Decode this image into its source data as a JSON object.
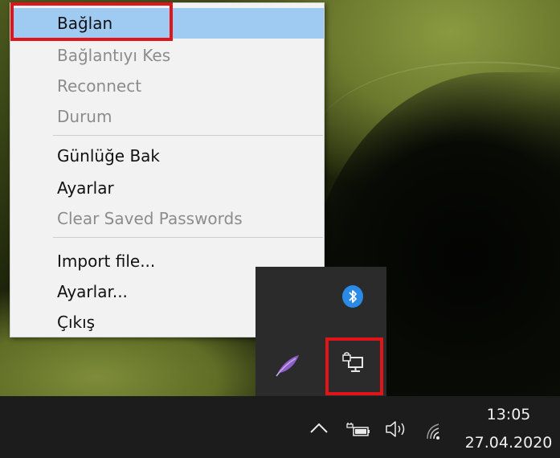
{
  "context_menu": {
    "items": [
      {
        "label": "Bağlan",
        "state": "highlighted"
      },
      {
        "label": "Bağlantıyı Kes",
        "state": "disabled"
      },
      {
        "label": "Reconnect",
        "state": "disabled"
      },
      {
        "label": "Durum",
        "state": "disabled"
      },
      {
        "label": "Günlüğe Bak",
        "state": "enabled"
      },
      {
        "label": "Ayarlar",
        "state": "enabled"
      },
      {
        "label": "Clear Saved Passwords",
        "state": "disabled"
      },
      {
        "label": "Import file...",
        "state": "enabled"
      },
      {
        "label": "Ayarlar...",
        "state": "enabled"
      },
      {
        "label": "Çıkış",
        "state": "enabled"
      }
    ]
  },
  "tray_flyout": {
    "icons": [
      "bluetooth-icon",
      "feather-icon",
      "vpn-network-icon"
    ]
  },
  "taskbar": {
    "icons": [
      "chevron-up-icon",
      "battery-icon",
      "volume-icon",
      "wifi-icon"
    ],
    "clock": {
      "time": "13:05",
      "date": "27.04.2020"
    }
  },
  "colors": {
    "menu_background": "#f2f2f2",
    "menu_highlight": "#9fcbf2",
    "annotation_red": "#e0141b",
    "taskbar": "#1c1c1c",
    "bluetooth_blue": "#2a8ae6"
  }
}
